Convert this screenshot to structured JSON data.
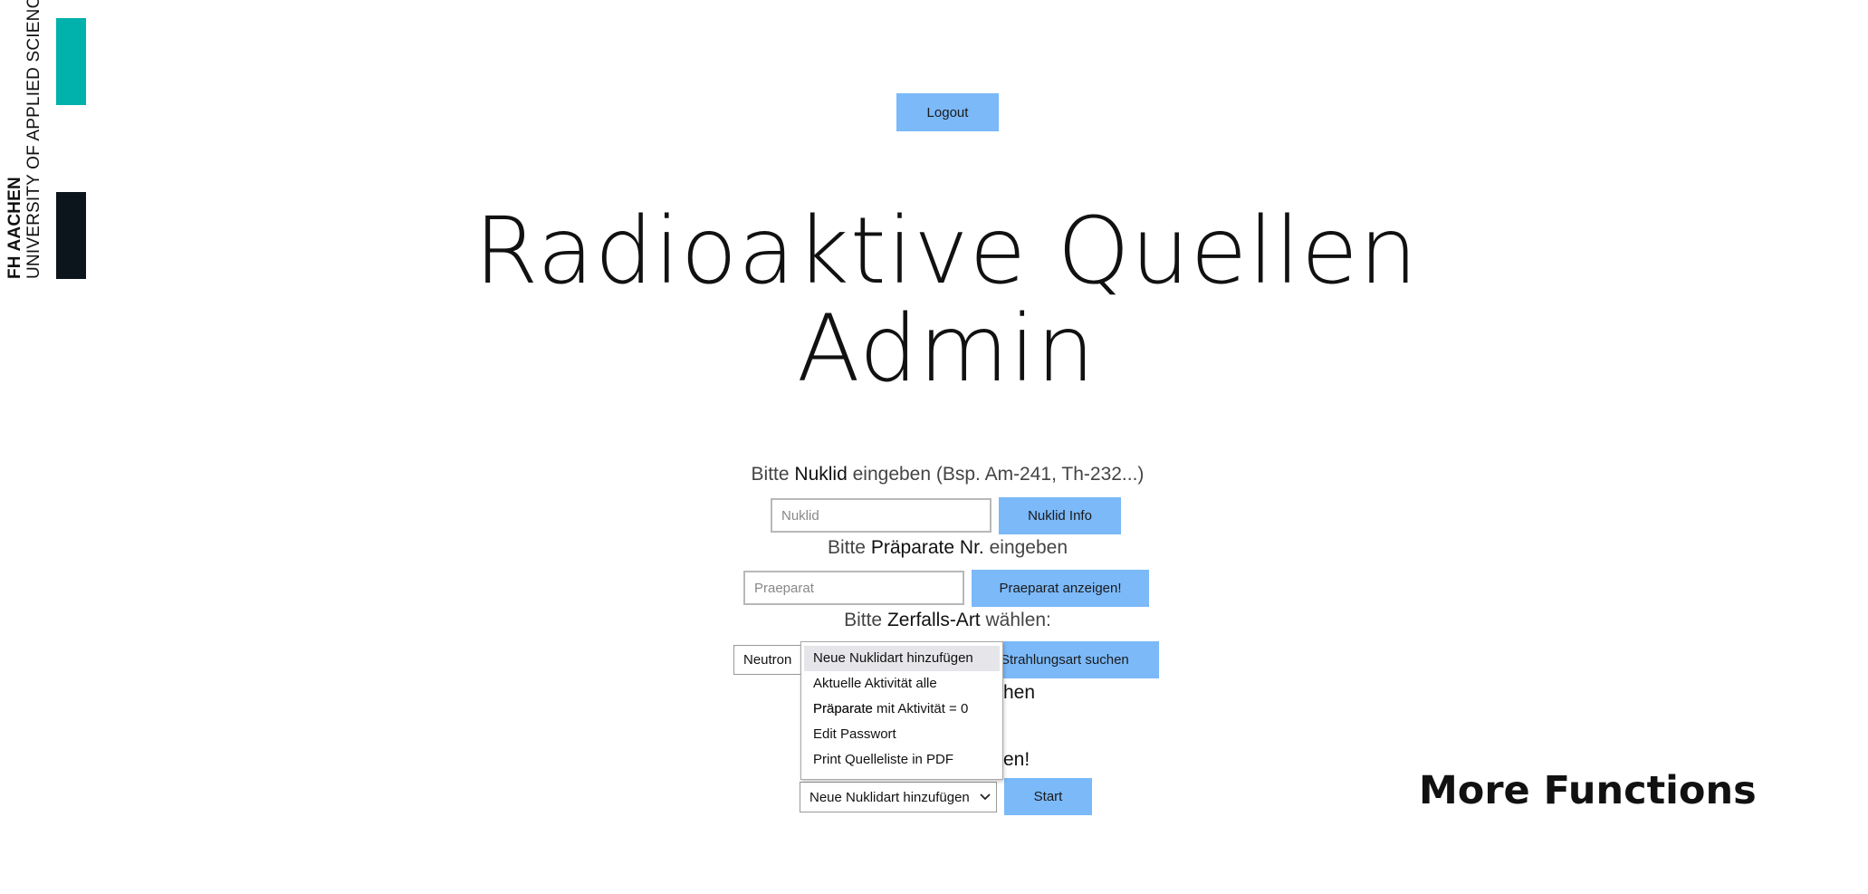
{
  "logo": {
    "line1": "FH AACHEN",
    "line2": "UNIVERSITY OF APPLIED SCIENCES",
    "colors": {
      "teal": "#00b1ac",
      "dark": "#0c151c"
    }
  },
  "header": {
    "logout_label": "Logout"
  },
  "title": {
    "line1": "Radioaktive Quellen",
    "line2": "Admin"
  },
  "nuklid": {
    "prompt_pre": "Bitte",
    "prompt_strong": "Nuklid",
    "prompt_post": "eingeben (Bsp. Am-241, Th-232...)",
    "placeholder": "Nuklid",
    "button_label": "Nuklid Info"
  },
  "praeparat": {
    "prompt_pre": "Bitte",
    "prompt_strong": "Präparate Nr.",
    "prompt_post": "eingeben",
    "placeholder": "Praeparat",
    "button_label": "Praeparat anzeigen!"
  },
  "zerfall": {
    "prompt_pre": "Bitte",
    "prompt_strong": "Zerfalls-Art",
    "prompt_post": "wählen:",
    "selected": "Neutron",
    "button_label": "Strahlungsart suchen"
  },
  "hidden_fragments": {
    "row1": "hen",
    "row2": "en!"
  },
  "functions": {
    "options": [
      "Neue Nuklidart hinzufügen",
      "Aktuelle Aktivität alle Präparate",
      "Präparate mit Aktivität = 0",
      "Edit Passwort",
      "Print Quelleliste in PDF"
    ],
    "selected": "Neue Nuklidart hinzufügen",
    "start_label": "Start"
  },
  "more_functions": "More Functions",
  "accent_color": "#7bb9f9"
}
